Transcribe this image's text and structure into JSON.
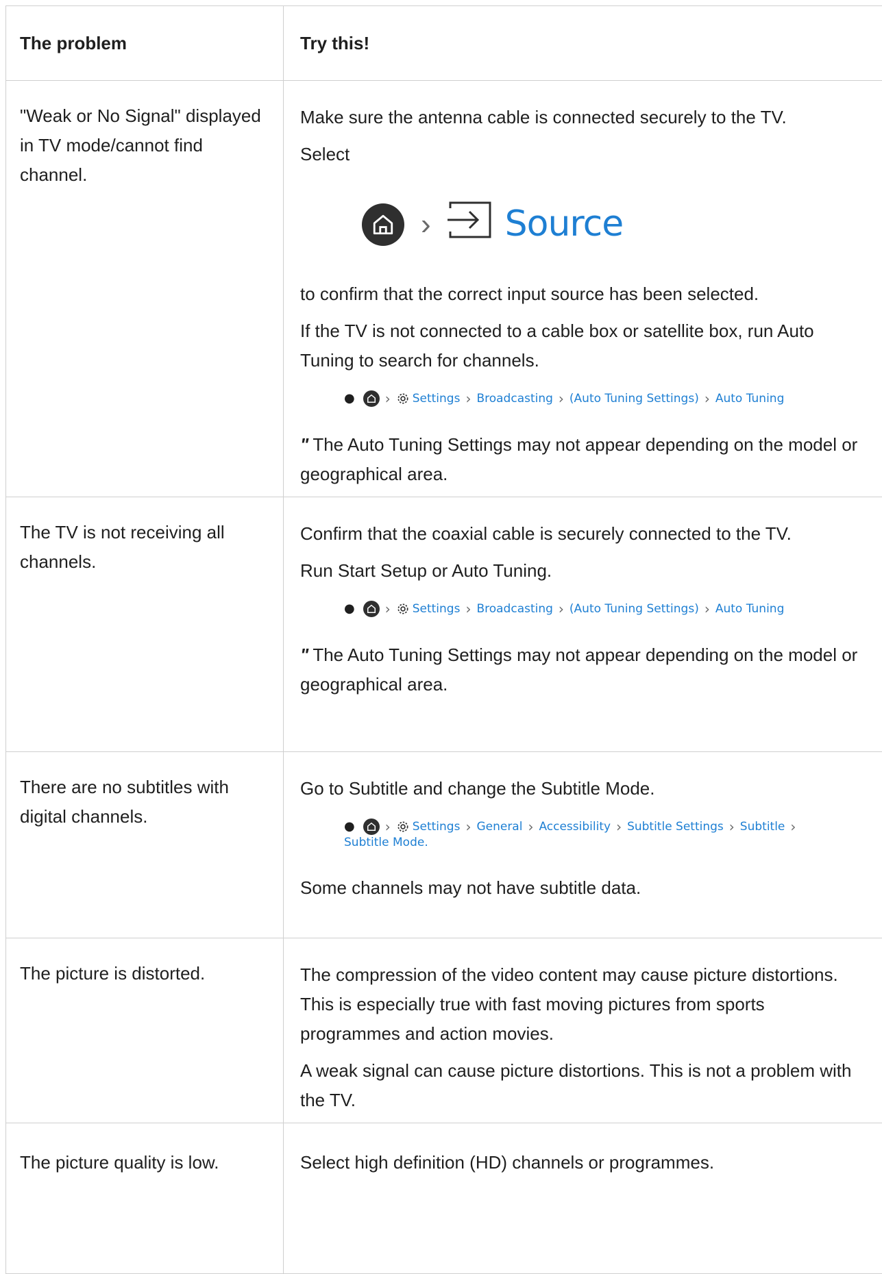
{
  "table": {
    "header": {
      "problem": "The problem",
      "fix": "Try this!"
    },
    "rows": [
      {
        "problem": "\"Weak or No Signal\" displayed in TV mode/cannot find channel.",
        "fix_1": "Make sure the antenna cable is connected securely to the TV.",
        "fix_2": "Select",
        "source_label": "Source",
        "fix_3": "to confirm that the correct input source has been selected.",
        "fix_4": "If the TV is not connected to a cable box or satellite box, run Auto Tuning to search for channels.",
        "path": [
          "Settings",
          "Broadcasting",
          "(Auto Tuning Settings)",
          "Auto Tuning"
        ],
        "note_mark": "\"",
        "note": "The Auto Tuning Settings may not appear depending on the model or geographical area."
      },
      {
        "problem": "The TV is not receiving all channels.",
        "fix_1": "Confirm that the coaxial cable is securely connected to the TV.",
        "fix_2": "Run Start Setup or Auto Tuning.",
        "path": [
          "Settings",
          "Broadcasting",
          "(Auto Tuning Settings)",
          "Auto Tuning"
        ],
        "note_mark": "\"",
        "note": "The Auto Tuning Settings may not appear depending on the model or geographical area."
      },
      {
        "problem": "There are no subtitles with digital channels.",
        "fix_1": "Go to Subtitle and change the Subtitle Mode.",
        "path": [
          "Settings",
          "General",
          "Accessibility",
          "Subtitle Settings",
          "Subtitle",
          "Subtitle Mode."
        ],
        "fix_2": "Some channels may not have subtitle data."
      },
      {
        "problem": "The picture is distorted.",
        "fix_1": "The compression of the video content may cause picture distortions. This is especially true with fast moving pictures from sports programmes and action movies.",
        "fix_2": "A weak signal can cause picture distortions. This is not a problem with the TV."
      },
      {
        "problem": "The picture quality is low.",
        "fix_1": "Select high definition (HD) channels or programmes."
      }
    ]
  }
}
